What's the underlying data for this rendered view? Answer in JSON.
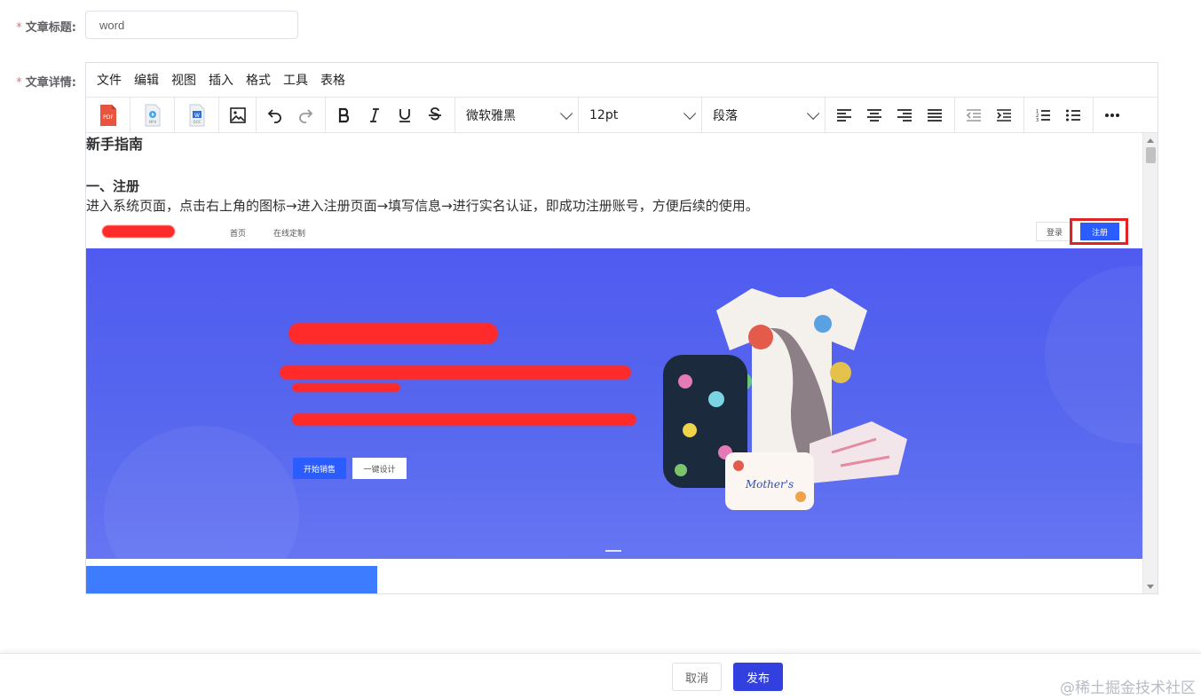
{
  "form": {
    "required_mark": "*",
    "title_label": "文章标题:",
    "title_value": "word",
    "detail_label": "文章详情:"
  },
  "editor": {
    "menus": [
      "文件",
      "编辑",
      "视图",
      "插入",
      "格式",
      "工具",
      "表格"
    ],
    "toolbar": {
      "insert_icons": [
        "pdf-icon",
        "mp4-video-icon",
        "word-doc-icon",
        "image-icon"
      ],
      "history_icons": [
        "undo-icon",
        "redo-icon"
      ],
      "format_icons": [
        "bold-icon",
        "italic-icon",
        "underline-icon",
        "strikethrough-icon"
      ],
      "font_family": "微软雅黑",
      "font_size": "12pt",
      "block_format": "段落",
      "align_icons": [
        "align-left-icon",
        "align-center-icon",
        "align-right-icon",
        "align-justify-icon"
      ],
      "indent_icons": [
        "outdent-icon",
        "indent-icon"
      ],
      "list_icons": [
        "numbered-list-icon",
        "bullet-list-icon"
      ],
      "more_icon": "more-icon"
    },
    "content": {
      "heading": "新手指南",
      "section1_title": "一、注册",
      "section1_text": "进入系统页面，点击右上角的图标→进入注册页面→填写信息→进行实名认证，即成功注册账号，方便后续的使用。",
      "screenshot": {
        "nav_home": "首页",
        "nav_custom": "在线定制",
        "login": "登录",
        "register": "注册",
        "hero_btn_primary": "开始销售",
        "hero_btn_secondary": "一键设计",
        "highlight_color": "#e02424",
        "hero_color": "#5666ee"
      }
    }
  },
  "footer": {
    "cancel": "取消",
    "publish": "发布",
    "watermark": "@稀土掘金技术社区"
  },
  "colors": {
    "primary": "#3340e0",
    "required": "#f56c6c"
  }
}
